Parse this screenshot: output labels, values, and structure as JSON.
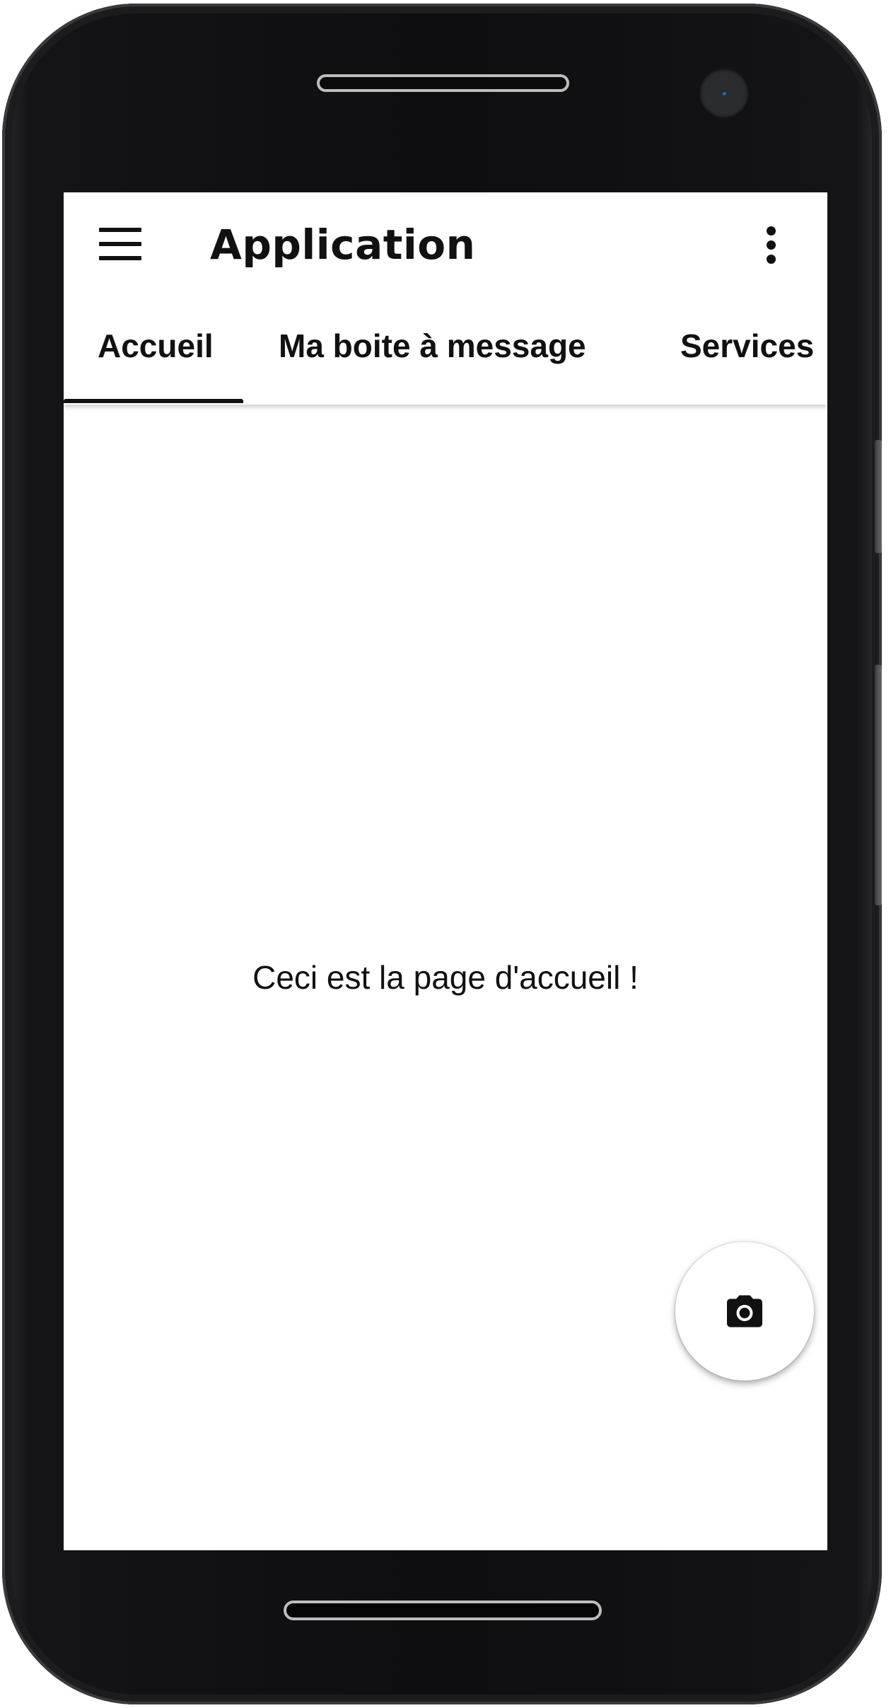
{
  "app": {
    "title": "Application"
  },
  "tabs": [
    {
      "label": "Accueil",
      "selected": true
    },
    {
      "label": "Ma boite à message",
      "selected": false
    },
    {
      "label": "Services",
      "selected": false
    }
  ],
  "content": {
    "text": "Ceci est la page d'accueil !"
  },
  "icons": {
    "menu": "hamburger-menu-icon",
    "more": "more-vert-icon",
    "fab": "camera-icon"
  },
  "colors": {
    "appbar_background": "#ffffff",
    "text": "#111111",
    "tab_indicator": "#111111",
    "fab_background": "#ffffff"
  }
}
